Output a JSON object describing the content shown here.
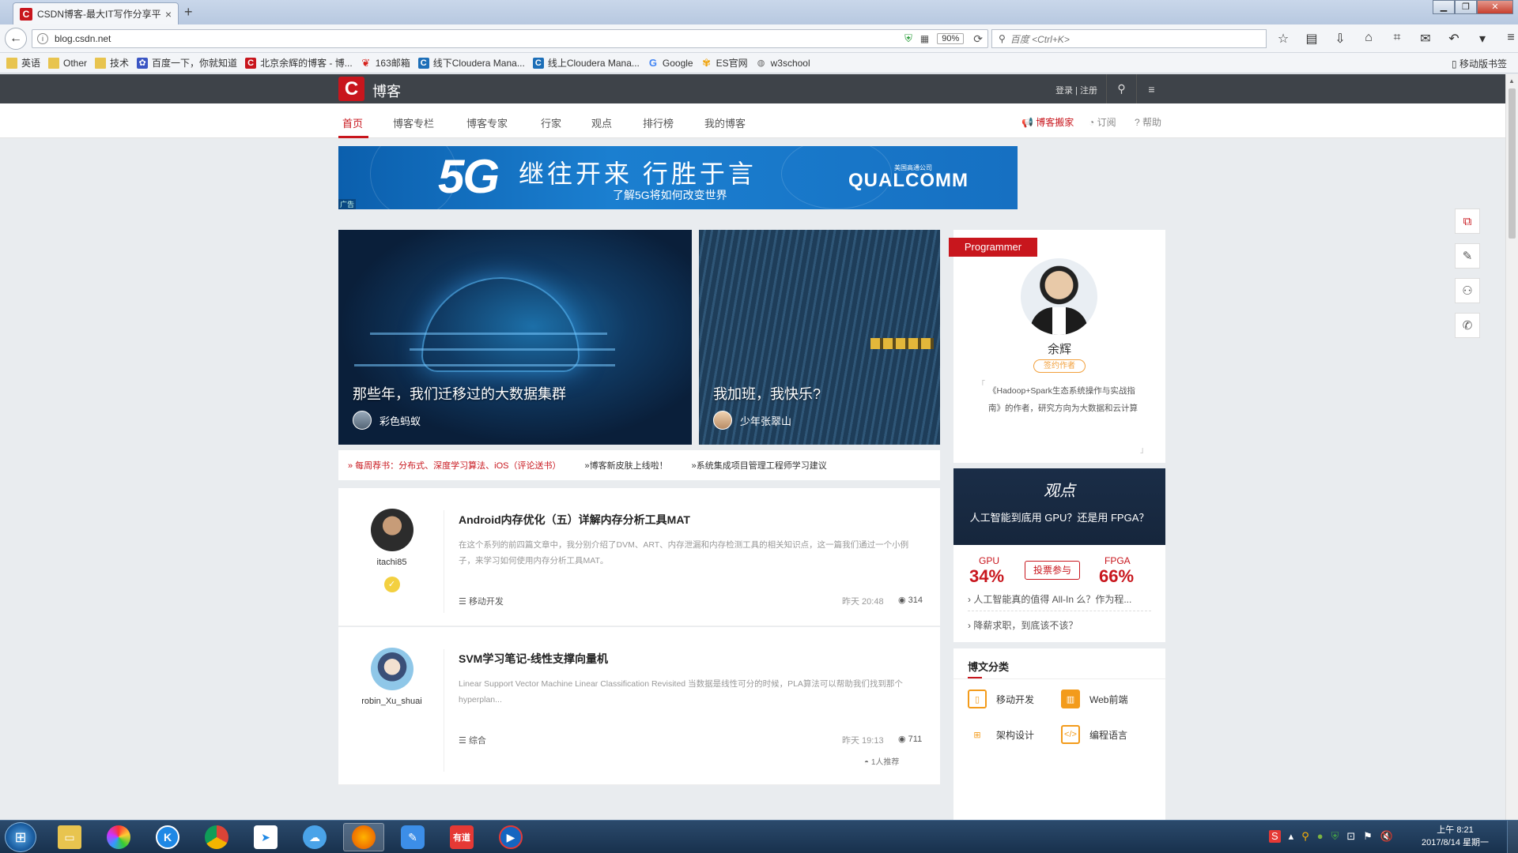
{
  "browser": {
    "tab_title": "CSDN博客-最大IT写作分享平",
    "tab_favicon": "C",
    "url": "blog.csdn.net",
    "zoom": "90%",
    "search_placeholder": "百度 <Ctrl+K>",
    "bookmarks": [
      {
        "label": "英语",
        "icon": "folder"
      },
      {
        "label": "Other",
        "icon": "folder"
      },
      {
        "label": "技术",
        "icon": "folder"
      },
      {
        "label": "百度一下，你就知道",
        "icon": "paw"
      },
      {
        "label": "北京余辉的博客 - 博...",
        "icon": "csdn"
      },
      {
        "label": "163邮箱",
        "icon": "m163"
      },
      {
        "label": "线下Cloudera Mana...",
        "icon": "cdh"
      },
      {
        "label": "线上Cloudera Mana...",
        "icon": "cdh"
      },
      {
        "label": "Google",
        "icon": "g"
      },
      {
        "label": "ES官网",
        "icon": "es"
      },
      {
        "label": "w3school",
        "icon": "w3"
      }
    ],
    "mobile_bookmarks": "移动版书签"
  },
  "site": {
    "logo_letter": "C",
    "logo_text": "博客",
    "login": "登录 | 注册",
    "nav": [
      "首页",
      "博客专栏",
      "博客专家",
      "行家",
      "观点",
      "排行榜",
      "我的博客"
    ],
    "nav_right": [
      "博客搬家",
      "订阅",
      "帮助"
    ]
  },
  "banner": {
    "big": "5G",
    "slogan": "继往开来 行胜于言",
    "sub": "了解5G将如何改变世界",
    "brand": "QUALCOMM",
    "brand_cn": "美国高通公司",
    "ad": "广告"
  },
  "features": [
    {
      "title": "那些年，我们迁移过的大数据集群",
      "author": "彩色蚂蚁"
    },
    {
      "title": "我加班，我快乐?",
      "author": "少年张翠山"
    }
  ],
  "recommend": [
    "» 每周荐书：分布式、深度学习算法、iOS（评论送书）",
    "»博客新皮肤上线啦！",
    "»系统集成项目管理工程师学习建议"
  ],
  "articles": [
    {
      "user": "itachi85",
      "badge": "✓",
      "title": "Android内存优化（五）详解内存分析工具MAT",
      "desc": "在这个系列的前四篇文章中，我分别介绍了DVM、ART、内存泄漏和内存检测工具的相关知识点，这一篇我们通过一个小例子，来学习如何使用内存分析工具MAT。",
      "category": "移动开发",
      "time": "昨天 20:48",
      "views": "314"
    },
    {
      "user": "robin_Xu_shuai",
      "title": "SVM学习笔记-线性支撑向量机",
      "desc": "Linear Support Vector Machine Linear Classification Revisited 当数据是线性可分的时候，PLA算法可以帮助我们找到那个hyperplan...",
      "category": "综合",
      "time": "昨天 19:13",
      "views": "711",
      "recommend": "1人推荐"
    }
  ],
  "programmer": {
    "tag": "Programmer",
    "name": "余辉",
    "sign": "签约作者",
    "desc": "《Hadoop+Spark生态系统操作与实战指南》的作者，研究方向为大数据和云计算"
  },
  "vote": {
    "logo": "观点",
    "question": "人工智能到底用 GPU？还是用 FPGA？",
    "left_label": "GPU",
    "left_pct": "34%",
    "right_label": "FPGA",
    "right_pct": "66%",
    "button": "投票参与",
    "links": [
      "人工智能真的值得 All-In 么？作为程...",
      "降薪求职，到底该不该？"
    ]
  },
  "categories": {
    "title": "博文分类",
    "items": [
      "移动开发",
      "Web前端",
      "架构设计",
      "编程语言"
    ]
  },
  "taskbar": {
    "time": "上午 8:21",
    "date": "2017/8/14 星期一",
    "youdao": "有道",
    "k": "K"
  },
  "colors": {
    "brand": "#c8161d",
    "header": "#3e4349",
    "accent_orange": "#f39b1b"
  }
}
